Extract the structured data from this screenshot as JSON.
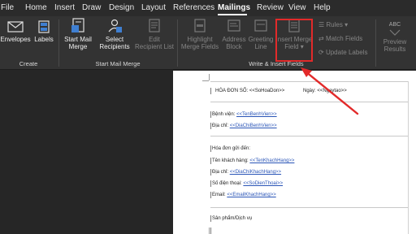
{
  "menu": {
    "tabs": [
      "File",
      "Home",
      "Insert",
      "Draw",
      "Design",
      "Layout",
      "References",
      "Mailings",
      "Review",
      "View",
      "Help"
    ],
    "active": "Mailings"
  },
  "ribbon": {
    "create": {
      "envelopes": "Envelopes",
      "labels": "Labels",
      "group_label": "Create"
    },
    "start_mail_merge": {
      "start_mail_merge": [
        "Start Mail",
        "Merge"
      ],
      "select_recipients": [
        "Select",
        "Recipients"
      ],
      "edit_recipient_list": [
        "Edit",
        "Recipient List"
      ],
      "group_label": "Start Mail Merge"
    },
    "write_insert": {
      "highlight_merge_fields": [
        "Highlight",
        "Merge Fields"
      ],
      "address_block": [
        "Address",
        "Block"
      ],
      "greeting_line": [
        "Greeting",
        "Line"
      ],
      "insert_merge_field": [
        "Insert Merge",
        "Field"
      ],
      "rules": "Rules",
      "match_fields": "Match Fields",
      "update_labels": "Update Labels",
      "group_label": "Write & Insert Fields"
    },
    "preview": {
      "abc": "ABC",
      "preview_results": [
        "Preview",
        "Results"
      ]
    }
  },
  "document": {
    "invoice_no_label": "HÓA ĐƠN SỐ:",
    "invoice_no_field": "<<SoHoaDon>>",
    "date_label": "Ngày:",
    "date_field": "<<Ngaytao>>",
    "hospital_label": "Bệnh viện:",
    "hospital_field": "<<TenBenhVien>>",
    "address1_label": "Địa chỉ:",
    "address1_field": "<<DiaChiBenhVien>>",
    "invoice_to": "Hóa đơn gửi đến:",
    "customer_label": "Tên khách hàng:",
    "customer_field": "<<TenKhachHang>>",
    "address2_label": "Địa chỉ:",
    "address2_field": "<<DiaChiKhachHang>>",
    "phone_label": "Số điện thoại:",
    "phone_field": "<<SoDienThoai>>",
    "email_label": "Email:",
    "email_field": "<<EmailKhachHang>>",
    "products": "Sản phẩm/Dịch vụ"
  },
  "colors": {
    "highlight_box": "#e22a2a",
    "arrow": "#e22a2a",
    "field_text": "#2a55b7",
    "ribbon_bg": "#333333"
  }
}
